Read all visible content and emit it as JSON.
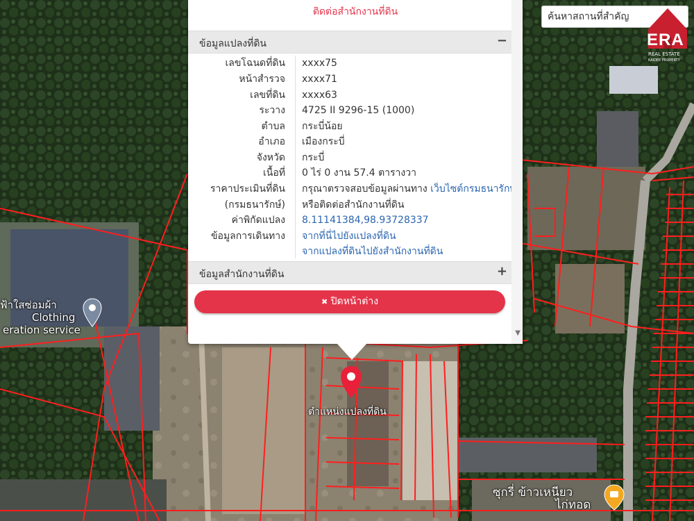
{
  "search": {
    "placeholder": "ค้นหาสถานที่สำคัญ"
  },
  "brand": {
    "logo_text": "ERA",
    "sub1": "REAL ESTATE",
    "sub2": "KAIDEE PROPERTY",
    "color": "#c8202f"
  },
  "popup": {
    "contact_link": "ติดต่อสำนักงานที่ดิน",
    "land_section": {
      "title": "ข้อมูลแปลงที่ดิน",
      "toggle": "−",
      "rows": [
        {
          "label": "เลขโฉนดที่ดิน",
          "value": "xxxx75"
        },
        {
          "label": "หน้าสำรวจ",
          "value": "xxxx71"
        },
        {
          "label": "เลขที่ดิน",
          "value": "xxxx63"
        },
        {
          "label": "ระวาง",
          "value": "4725 II 9296-15 (1000)"
        },
        {
          "label": "ตำบล",
          "value": "กระบี่น้อย"
        },
        {
          "label": "อำเภอ",
          "value": "เมืองกระบี่"
        },
        {
          "label": "จังหวัด",
          "value": "กระบี่"
        },
        {
          "label": "เนื้อที่",
          "value": "0 ไร่ 0 งาน 57.4 ตารางวา"
        }
      ],
      "appraisal_label": "ราคาประเมินที่ดิน",
      "appraisal_text": "กรุณาตรวจสอบข้อมูลผ่านทาง ",
      "appraisal_link": "เว็บไซต์กรมธนารักษ์",
      "treasury_label": "(กรมธนารักษ์)",
      "treasury_text": "หรือติดต่อสำนักงานที่ดิน",
      "coord_label": "ค่าพิกัดแปลง",
      "coord_value": "8.11141384,98.93728337",
      "travel_label": "ข้อมูลการเดินทาง",
      "travel_link1": "จากที่นี่ไปยังแปลงที่ดิน",
      "travel_link2": "จากแปลงที่ดินไปยังสำนักงานที่ดิน"
    },
    "office_section": {
      "title": "ข้อมูลสำนักงานที่ดิน",
      "toggle": "+"
    },
    "close_button": {
      "icon": "✖",
      "label": " ปิดหน้าต่าง"
    }
  },
  "map": {
    "pin_label": "ตำแหน่งแปลงที่ดิน",
    "poi_left_line1": "ฟ้าใสซ่อมผ้า",
    "poi_left_line2": "Clothing",
    "poi_left_line3": "eration service",
    "poi_bottom_line1": "ซุกรี่ ข้าวเหนียว",
    "poi_bottom_line2": "ไก่ทอด",
    "parcel_color": "#ff1e1e",
    "pin_color": "#e8203a"
  }
}
